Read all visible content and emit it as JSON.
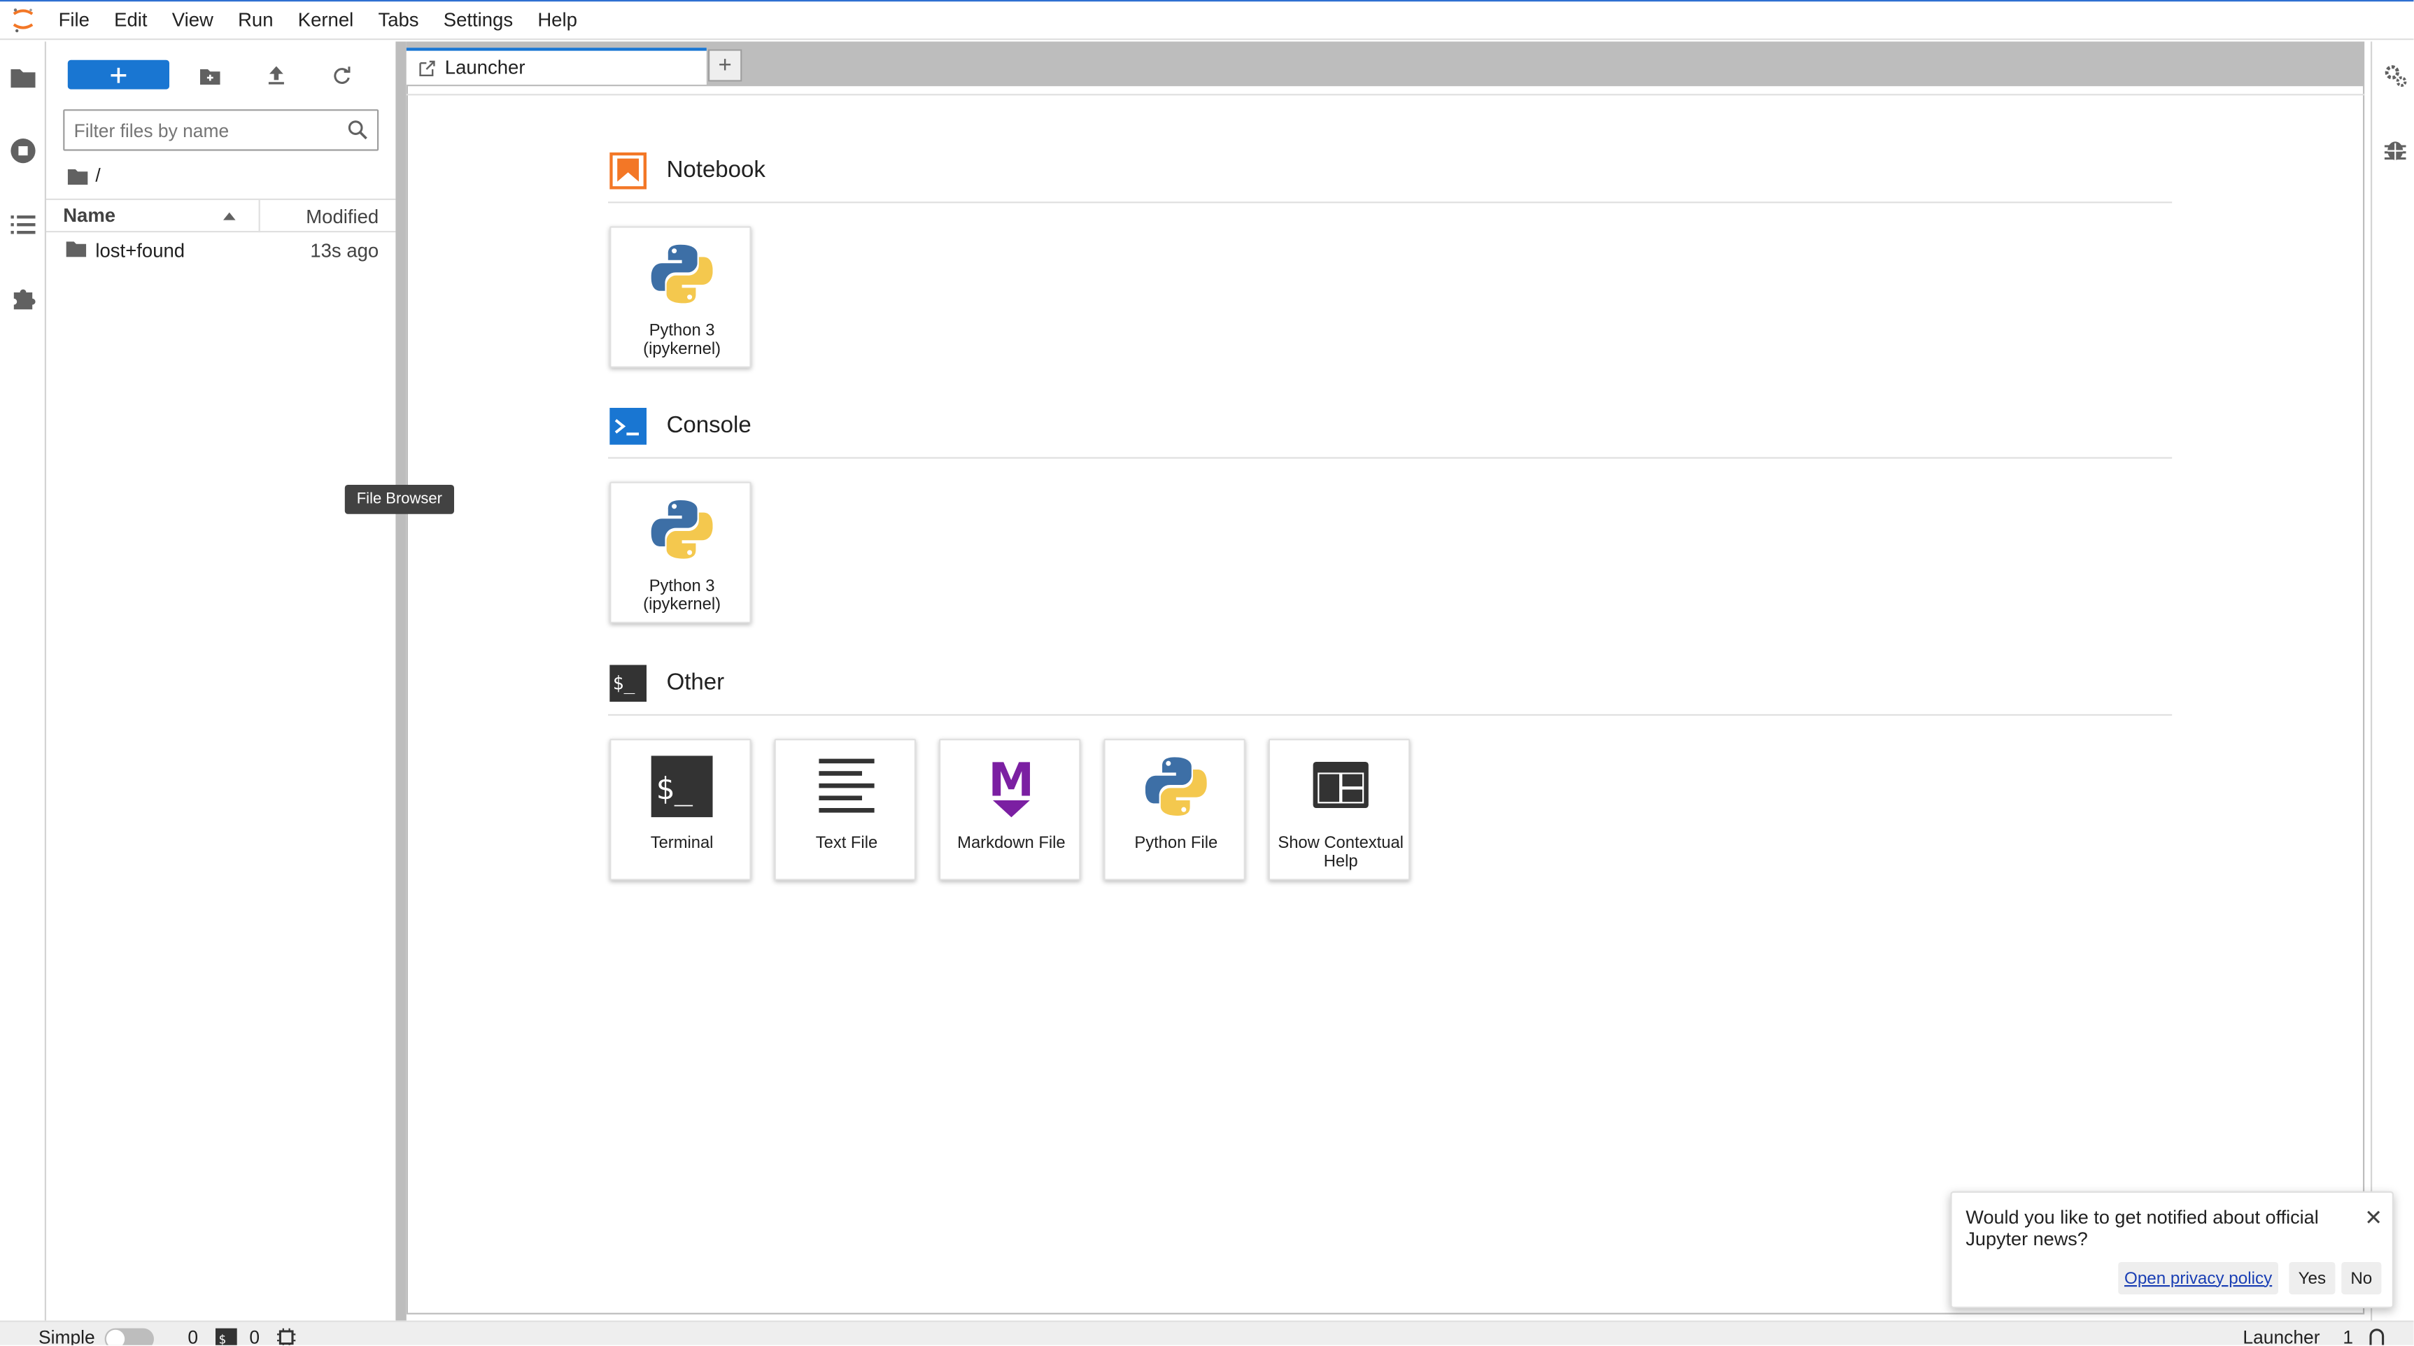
{
  "menu": [
    "File",
    "Edit",
    "View",
    "Run",
    "Kernel",
    "Tabs",
    "Settings",
    "Help"
  ],
  "filebrowser": {
    "filter_placeholder": "Filter files by name",
    "breadcrumb": "/",
    "col_name": "Name",
    "col_modified": "Modified",
    "files": [
      {
        "name": "lost+found",
        "modified": "13s ago"
      }
    ]
  },
  "tooltip": "File Browser",
  "tab": {
    "label": "Launcher"
  },
  "launcher": {
    "sections": [
      {
        "title": "Notebook",
        "cards": [
          {
            "label": "Python 3 (ipykernel)"
          }
        ]
      },
      {
        "title": "Console",
        "cards": [
          {
            "label": "Python 3 (ipykernel)"
          }
        ]
      },
      {
        "title": "Other",
        "cards": [
          {
            "label": "Terminal"
          },
          {
            "label": "Text File"
          },
          {
            "label": "Markdown File"
          },
          {
            "label": "Python File"
          },
          {
            "label": "Show Contextual Help"
          }
        ]
      }
    ]
  },
  "statusbar": {
    "mode": "Simple",
    "terminals": "0",
    "kernels": "0",
    "active": "Launcher",
    "count": "1"
  },
  "notification": {
    "message": "Would you like to get notified about official Jupyter news?",
    "privacy": "Open privacy policy",
    "yes": "Yes",
    "no": "No"
  },
  "colors": {
    "accent": "#1976d2",
    "notebook": "#f37726",
    "console": "#1976d2",
    "markdown": "#7b1fa2"
  }
}
